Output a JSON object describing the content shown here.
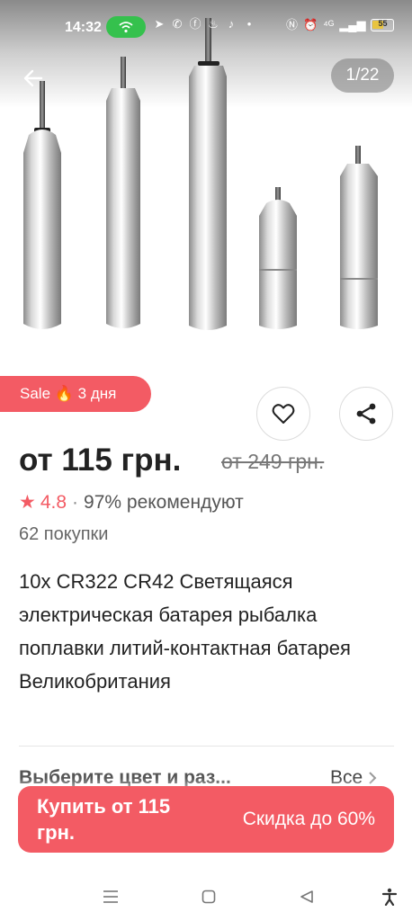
{
  "status_bar": {
    "time": "14:32",
    "battery_level": "55",
    "battery_fraction": 0.55,
    "icons_left": [
      "wifi-hotspot-icon",
      "telegram-icon",
      "viber-icon",
      "facebook-icon",
      "fire-icon",
      "tiktok-icon",
      "dot-icon"
    ],
    "icons_right": [
      "nfc-icon",
      "alarm-icon",
      "signal-4g-icon",
      "signal-bars-icon",
      "battery-icon"
    ],
    "accent": "#35c14d"
  },
  "gallery": {
    "counter": "1/22",
    "image_alt": "product-batteries-image"
  },
  "sale": {
    "label": "Sale",
    "fire": "🔥",
    "duration": "3 дня"
  },
  "price": {
    "current": "от 115 грн.",
    "old": "от 249 грн."
  },
  "rating": {
    "value": "4.8",
    "separator": "·",
    "recommend": "97% рекомендуют",
    "purchases": "62 покупки"
  },
  "product": {
    "title": "10x CR322 CR42 Светящаяся электрическая батарея рыбалка поплавки литий-контактная батарея Великобритания"
  },
  "variant": {
    "label": "Выберите цвет и раз...",
    "all": "Все"
  },
  "buy": {
    "label": "Купить от 115 грн.",
    "discount": "Скидка до 60%"
  },
  "colors": {
    "accent": "#f35b64",
    "text": "#222222",
    "muted": "#666666"
  }
}
